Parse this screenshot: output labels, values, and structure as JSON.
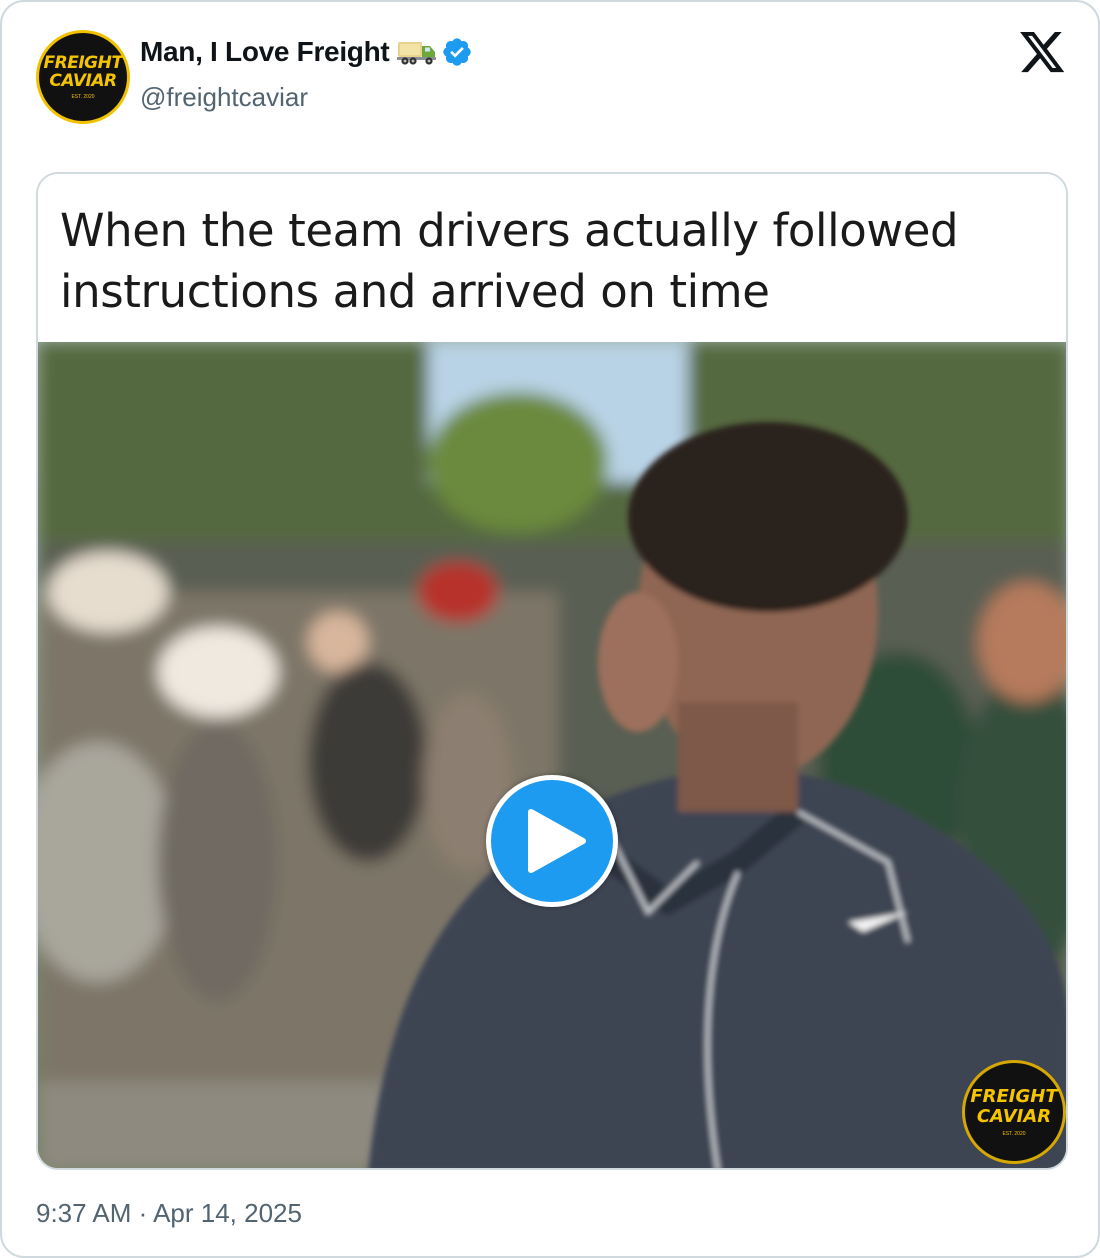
{
  "author": {
    "display_name": "Man, I Love Freight",
    "handle": "@freightcaviar",
    "avatar": {
      "line1": "FREIGHT",
      "line2": "CAVIAR",
      "line3": "EST. 2020"
    },
    "icons": [
      "truck-emoji-icon",
      "verified-badge-icon"
    ]
  },
  "platform_icon": "x-logo-icon",
  "media": {
    "caption": "When the team drivers actually followed instructions and arrived on time",
    "play_icon": "play-icon",
    "watermark": {
      "line1": "FREIGHT",
      "line2": "CAVIAR",
      "line3": "EST. 2020"
    }
  },
  "timestamp": "9:37 AM · Apr 14, 2025",
  "colors": {
    "accent": "#1d9bf0",
    "muted_text": "#536471",
    "border": "#cfd9de",
    "brand_yellow": "#f5c400"
  }
}
